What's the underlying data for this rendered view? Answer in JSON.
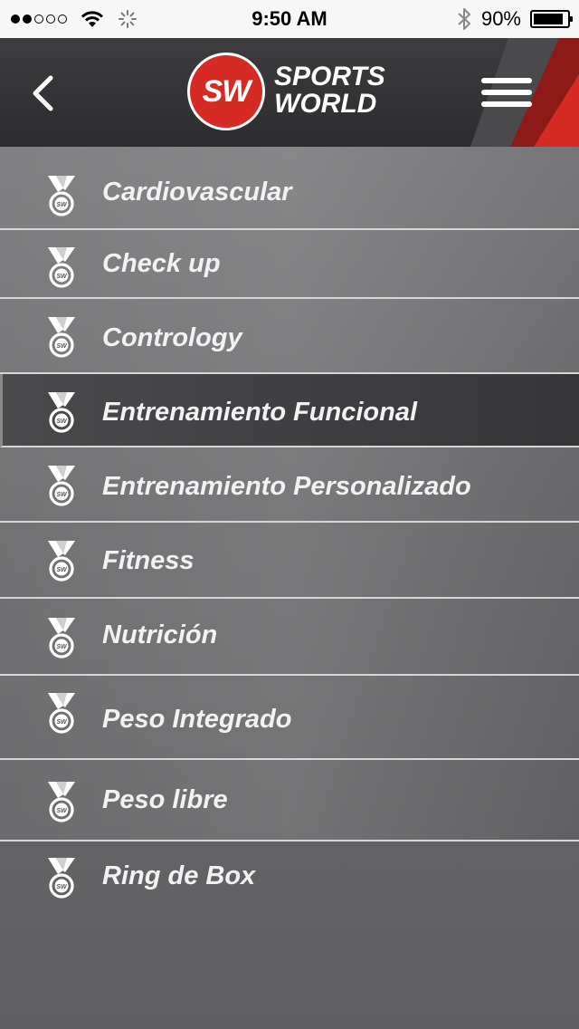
{
  "status_bar": {
    "time": "9:50 AM",
    "battery": "90%",
    "battery_level": 0.9,
    "signal_bars": 2,
    "signal_total": 5,
    "icons": [
      "signal-dots-icon",
      "wifi-icon",
      "activity-spinner-icon",
      "bluetooth-icon",
      "battery-icon"
    ]
  },
  "header": {
    "logo_mark": "SW",
    "logo_line1": "SPORTS",
    "logo_line2": "WORLD",
    "back_icon": "chevron-left-icon",
    "menu_icon": "hamburger-menu-icon",
    "accent_color": "#d62b24"
  },
  "items": [
    {
      "label": "Cardiovascular",
      "icon": "medal-icon",
      "selected": false
    },
    {
      "label": "Check up",
      "icon": "medal-icon",
      "selected": false
    },
    {
      "label": "Contrology",
      "icon": "medal-icon",
      "selected": false
    },
    {
      "label": "Entrenamiento Funcional",
      "icon": "medal-icon",
      "selected": true
    },
    {
      "label": "Entrenamiento Personalizado",
      "icon": "medal-icon",
      "selected": false
    },
    {
      "label": "Fitness",
      "icon": "medal-icon",
      "selected": false
    },
    {
      "label": "Nutrición",
      "icon": "medal-icon",
      "selected": false
    },
    {
      "label": "Peso Integrado",
      "icon": "medal-icon",
      "selected": false
    },
    {
      "label": "Peso libre",
      "icon": "medal-icon",
      "selected": false
    },
    {
      "label": "Ring de Box",
      "icon": "medal-icon",
      "selected": false
    }
  ]
}
